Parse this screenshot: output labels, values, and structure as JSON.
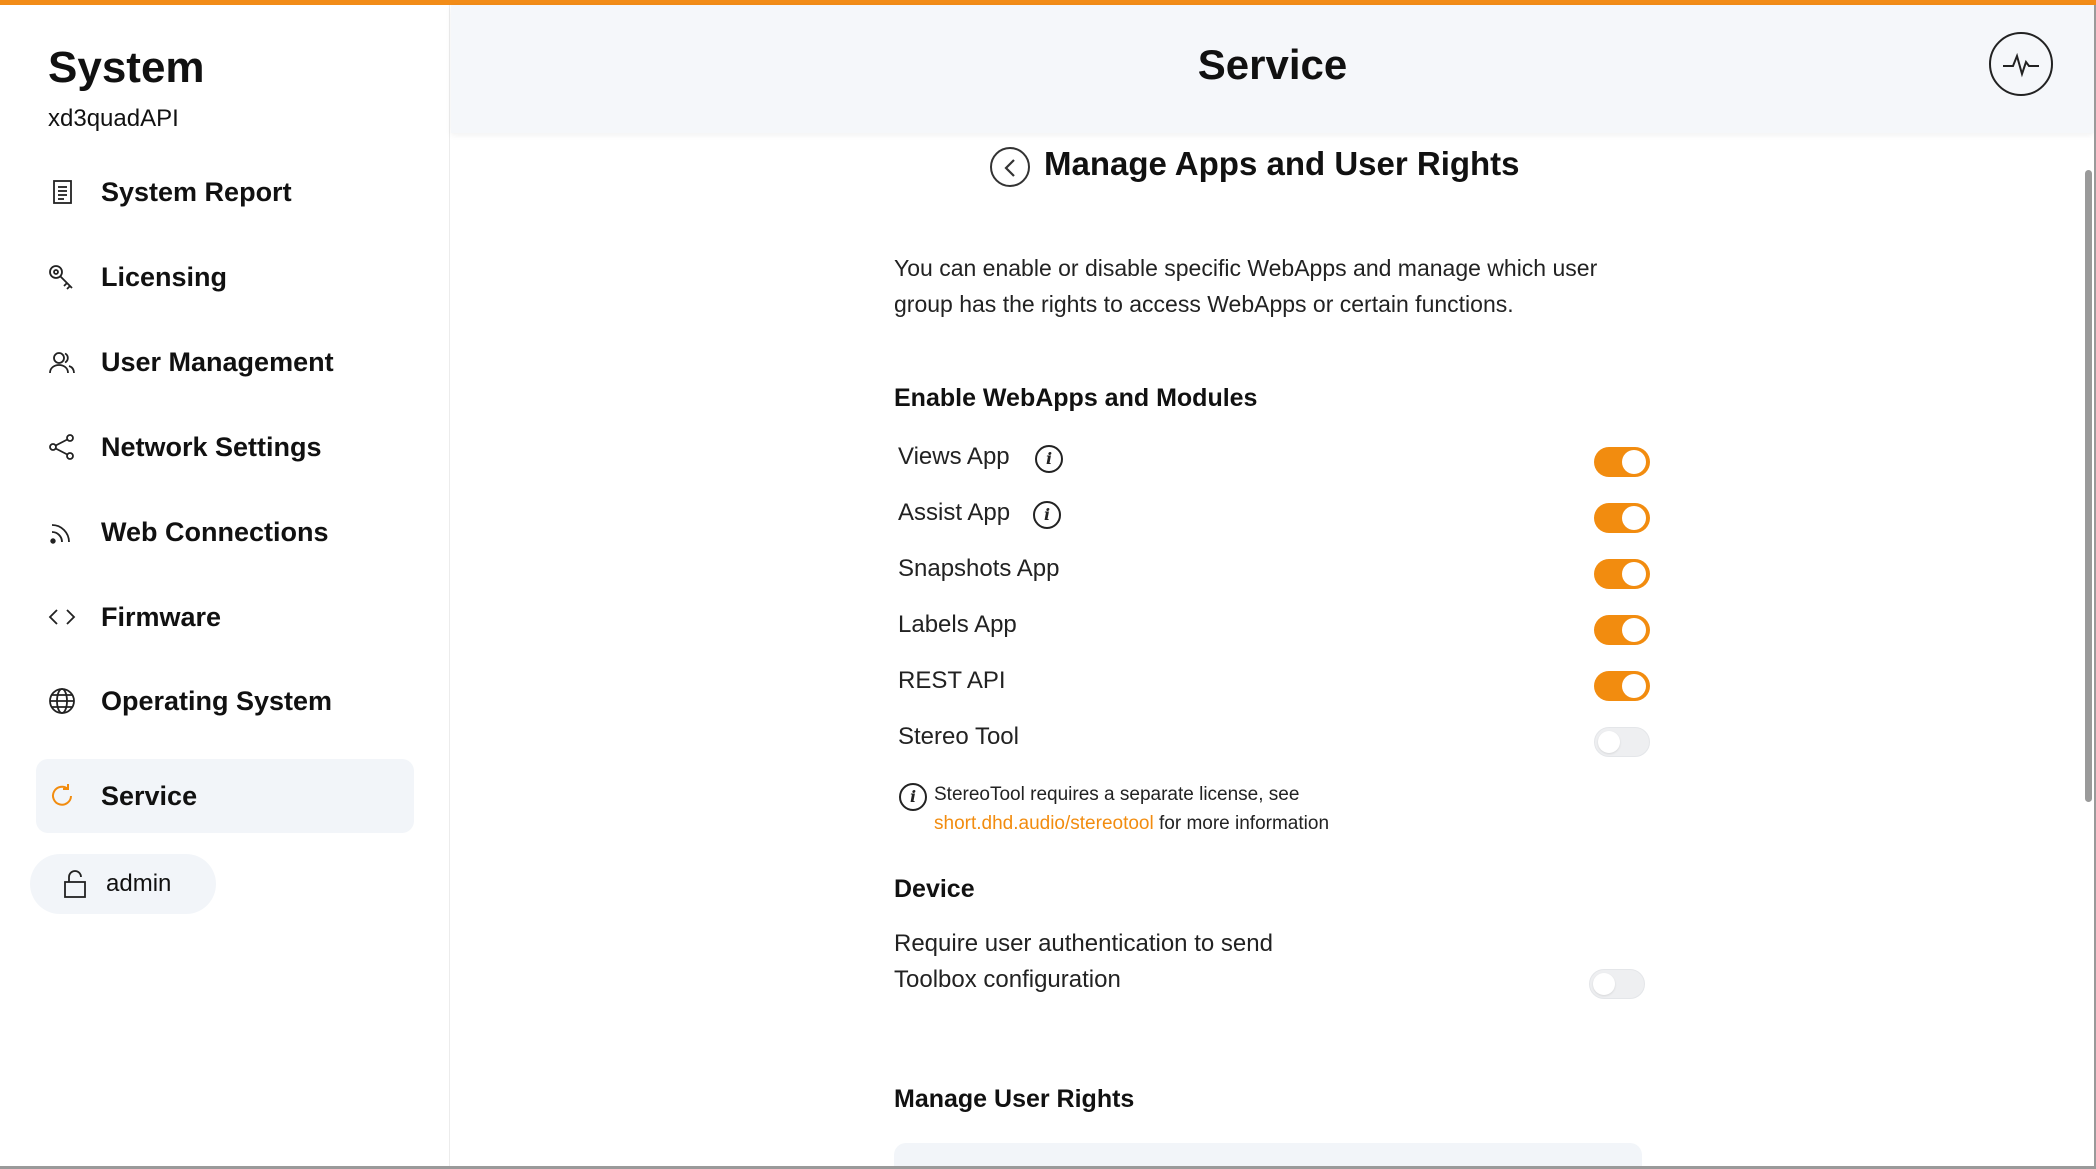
{
  "sidebar": {
    "title": "System",
    "subtitle": "xd3quadAPI",
    "items": [
      {
        "label": "System Report",
        "icon": "document-icon"
      },
      {
        "label": "Licensing",
        "icon": "key-icon"
      },
      {
        "label": "User Management",
        "icon": "users-icon"
      },
      {
        "label": "Network Settings",
        "icon": "share-icon"
      },
      {
        "label": "Web Connections",
        "icon": "rss-icon"
      },
      {
        "label": "Firmware",
        "icon": "code-icon"
      },
      {
        "label": "Operating System",
        "icon": "globe-icon"
      },
      {
        "label": "Service",
        "icon": "refresh-icon",
        "active": true
      }
    ],
    "user": {
      "name": "admin",
      "icon": "lock-icon"
    }
  },
  "header": {
    "title": "Service",
    "action_icon": "pulse-icon"
  },
  "main": {
    "title": "Manage Apps and User Rights",
    "intro": "You can enable or disable specific WebApps and manage which user group has the rights to access WebApps or certain functions.",
    "webapps": {
      "title": "Enable WebApps and Modules",
      "items": [
        {
          "label": "Views App",
          "info": true,
          "enabled": true
        },
        {
          "label": "Assist App",
          "info": true,
          "enabled": true
        },
        {
          "label": "Snapshots App",
          "info": false,
          "enabled": true
        },
        {
          "label": "Labels App",
          "info": false,
          "enabled": true
        },
        {
          "label": "REST API",
          "info": false,
          "enabled": true
        },
        {
          "label": "Stereo Tool",
          "info": false,
          "enabled": false
        }
      ],
      "note_prefix": "StereoTool requires a separate license, see",
      "note_link": "short.dhd.audio/stereotool",
      "note_suffix": " for more information"
    },
    "device": {
      "title": "Device",
      "auth_label": "Require user authentication to send Toolbox configuration",
      "auth_enabled": false
    },
    "user_rights": {
      "title": "Manage User Rights"
    }
  },
  "colors": {
    "accent": "#f28c0f",
    "sidebar_active_bg": "#f2f5f9",
    "header_bg": "#f5f7fa"
  }
}
